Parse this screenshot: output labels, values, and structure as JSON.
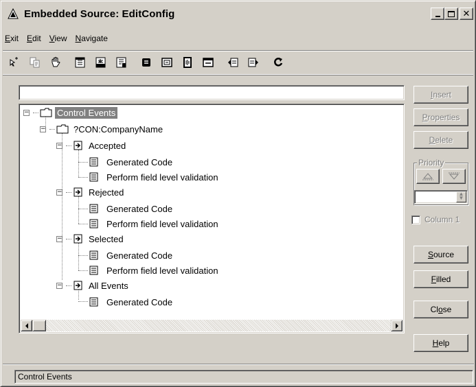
{
  "window": {
    "title": "Embedded Source: EditConfig"
  },
  "menu": [
    "Exit",
    "Edit",
    "View",
    "Navigate"
  ],
  "toolbar": {
    "icons": [
      "pointer-icon",
      "copy-embed-icon",
      "hand-icon",
      "insert-above-icon",
      "insert-below-icon",
      "insert-embed-icon",
      "expand-icon",
      "collapse-icon",
      "filter-icon",
      "window-icon",
      "prev-icon",
      "next-icon",
      "refresh-icon"
    ]
  },
  "filter": {
    "value": ""
  },
  "tree": {
    "root": "Control Events",
    "control": "?CON:CompanyName",
    "events": [
      {
        "name": "Accepted",
        "items": [
          "Generated Code",
          "Perform field level validation"
        ]
      },
      {
        "name": "Rejected",
        "items": [
          "Generated Code",
          "Perform field level validation"
        ]
      },
      {
        "name": "Selected",
        "items": [
          "Generated Code",
          "Perform field level validation"
        ]
      },
      {
        "name": "All Events",
        "items": [
          "Generated Code"
        ]
      }
    ]
  },
  "buttons": {
    "insert": {
      "acc": "I",
      "rest": "nsert"
    },
    "properties": {
      "acc": "P",
      "rest": "roperties"
    },
    "delete": {
      "acc": "D",
      "rest": "elete"
    },
    "source": {
      "acc": "S",
      "rest": "ource"
    },
    "filled": {
      "acc": "F",
      "rest": "illed"
    },
    "close": {
      "pre": "Cl",
      "acc": "o",
      "rest": "se"
    },
    "help": {
      "acc": "H",
      "rest": "elp"
    }
  },
  "priority": {
    "label": "Priority",
    "value": ""
  },
  "column": {
    "label": "Column 1",
    "checked": false
  },
  "status": {
    "text": "Control Events"
  },
  "colors": {
    "face": "#d4d0c8",
    "selection": "#808080",
    "disabled": "#808080"
  }
}
